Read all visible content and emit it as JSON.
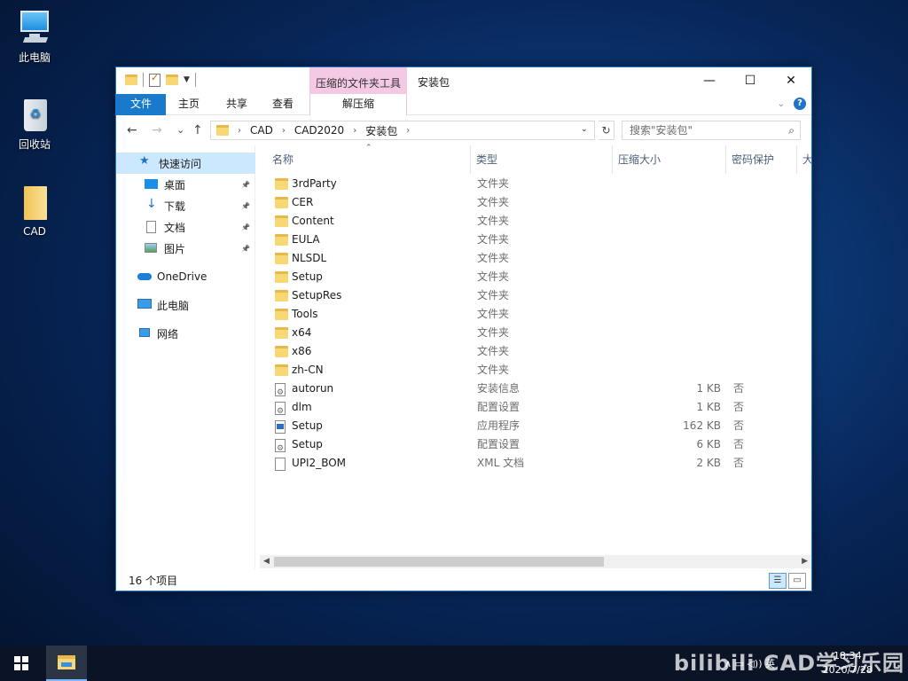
{
  "desktop": {
    "icons": [
      {
        "label": "此电脑"
      },
      {
        "label": "回收站"
      },
      {
        "label": "CAD"
      }
    ]
  },
  "window": {
    "title": "安装包",
    "context_tab": "压缩的文件夹工具",
    "context_subtab": "解压缩",
    "ribbon_tabs": [
      "文件",
      "主页",
      "共享",
      "查看"
    ],
    "controls": {
      "minimize": "—",
      "maximize": "☐",
      "close": "✕"
    }
  },
  "navigation": {
    "back": "←",
    "forward": "→",
    "recent": "⌄",
    "up": "↑",
    "breadcrumbs": [
      "CAD",
      "CAD2020",
      "安装包"
    ],
    "refresh": "↻",
    "search_placeholder": "搜索\"安装包\"",
    "search_icon": "⌕"
  },
  "sidebar": {
    "items": [
      {
        "label": "快速访问",
        "icon": "star-icon"
      },
      {
        "label": "桌面",
        "icon": "desktop-icon",
        "pinned": true
      },
      {
        "label": "下载",
        "icon": "download-icon",
        "pinned": true
      },
      {
        "label": "文档",
        "icon": "document-icon",
        "pinned": true
      },
      {
        "label": "图片",
        "icon": "pictures-icon",
        "pinned": true
      },
      {
        "label": "OneDrive",
        "icon": "cloud-icon"
      },
      {
        "label": "此电脑",
        "icon": "computer-icon"
      },
      {
        "label": "网络",
        "icon": "network-icon"
      }
    ],
    "pin_glyph": "📌"
  },
  "columns": {
    "name": "名称",
    "type": "类型",
    "size": "压缩大小",
    "protect": "密码保护",
    "more": "大"
  },
  "files": [
    {
      "name": "3rdParty",
      "type": "文件夹",
      "size": "",
      "protect": "",
      "kind": "folder"
    },
    {
      "name": "CER",
      "type": "文件夹",
      "size": "",
      "protect": "",
      "kind": "folder"
    },
    {
      "name": "Content",
      "type": "文件夹",
      "size": "",
      "protect": "",
      "kind": "folder"
    },
    {
      "name": "EULA",
      "type": "文件夹",
      "size": "",
      "protect": "",
      "kind": "folder"
    },
    {
      "name": "NLSDL",
      "type": "文件夹",
      "size": "",
      "protect": "",
      "kind": "folder"
    },
    {
      "name": "Setup",
      "type": "文件夹",
      "size": "",
      "protect": "",
      "kind": "folder"
    },
    {
      "name": "SetupRes",
      "type": "文件夹",
      "size": "",
      "protect": "",
      "kind": "folder"
    },
    {
      "name": "Tools",
      "type": "文件夹",
      "size": "",
      "protect": "",
      "kind": "folder"
    },
    {
      "name": "x64",
      "type": "文件夹",
      "size": "",
      "protect": "",
      "kind": "folder"
    },
    {
      "name": "x86",
      "type": "文件夹",
      "size": "",
      "protect": "",
      "kind": "folder"
    },
    {
      "name": "zh-CN",
      "type": "文件夹",
      "size": "",
      "protect": "",
      "kind": "folder"
    },
    {
      "name": "autorun",
      "type": "安装信息",
      "size": "1 KB",
      "protect": "否",
      "kind": "cfg"
    },
    {
      "name": "dlm",
      "type": "配置设置",
      "size": "1 KB",
      "protect": "否",
      "kind": "cfg"
    },
    {
      "name": "Setup",
      "type": "应用程序",
      "size": "162 KB",
      "protect": "否",
      "kind": "app"
    },
    {
      "name": "Setup",
      "type": "配置设置",
      "size": "6 KB",
      "protect": "否",
      "kind": "cfg"
    },
    {
      "name": "UPI2_BOM",
      "type": "XML 文档",
      "size": "2 KB",
      "protect": "否",
      "kind": "doc"
    }
  ],
  "status": {
    "count": "16 个项目"
  },
  "taskbar": {
    "tray_icons": "∧  ▭  ◁))  英",
    "time": "18:34",
    "date": "2020/7/28"
  },
  "watermark": "bilibili CAD学习乐园"
}
